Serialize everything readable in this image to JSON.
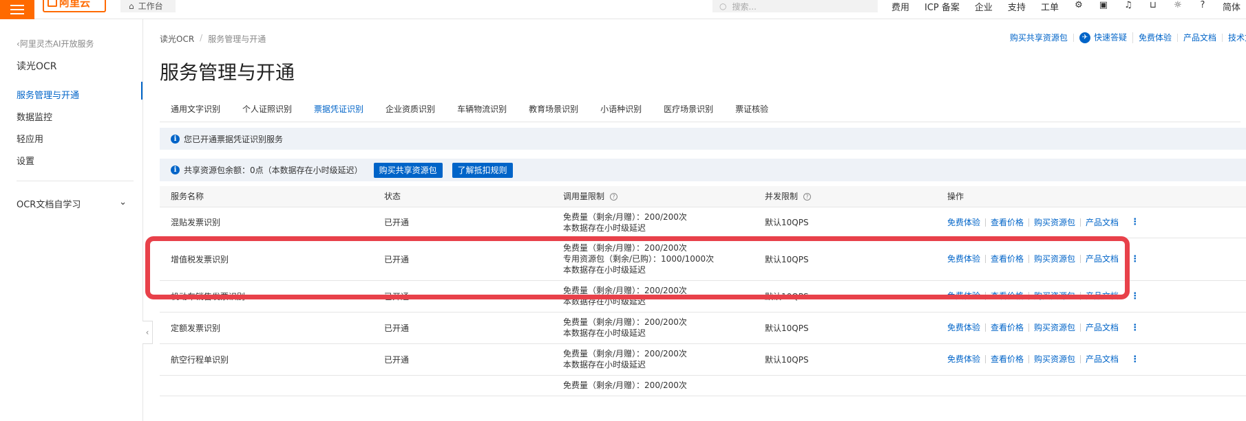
{
  "topbar": {
    "logo": "阿里云",
    "workbench": "工作台",
    "search_placeholder": "搜索...",
    "nav": [
      "费用",
      "ICP 备案",
      "企业",
      "支持",
      "工单"
    ],
    "lang": "简体",
    "icons": [
      "menu-icon",
      "home-icon",
      "search-icon",
      "robot-icon",
      "terminal-icon",
      "bell-icon",
      "cart-icon",
      "bulb-icon",
      "help-icon"
    ]
  },
  "sidebar": {
    "back": "阿里灵杰AI开放服务",
    "title": "读光OCR",
    "items": [
      "服务管理与开通",
      "数据监控",
      "轻应用",
      "设置"
    ],
    "collapse_item": "OCR文档自学习"
  },
  "breadcrumb": {
    "root": "读光OCR",
    "sep": "/",
    "current": "服务管理与开通"
  },
  "toplinks": [
    "购买共享资源包",
    "快速答疑",
    "免费体验",
    "产品文档",
    "技术文档"
  ],
  "page_title": "服务管理与开通",
  "tabs": [
    "通用文字识别",
    "个人证照识别",
    "票据凭证识别",
    "企业资质识别",
    "车辆物流识别",
    "教育场景识别",
    "小语种识别",
    "医疗场景识别",
    "票证核验"
  ],
  "active_tab": "票据凭证识别",
  "notice": "您已开通票据凭证识别服务",
  "quota": {
    "text": "共享资源包余额：0点（本数据存在小时级延迟）",
    "buy_button": "购买共享资源包",
    "rule_button": "了解抵扣规则"
  },
  "table": {
    "headers": [
      "服务名称",
      "状态",
      "调用量限制",
      "并发限制",
      "操作"
    ],
    "rows": [
      {
        "name": "混贴发票识别",
        "status": "已开通",
        "limits": [
          "免费量（剩余/月赠）：200/200次",
          "本数据存在小时级延迟"
        ],
        "concurrency": "默认10QPS"
      },
      {
        "name": "增值税发票识别",
        "status": "已开通",
        "limits": [
          "免费量（剩余/月赠）：200/200次",
          "专用资源包（剩余/已购）：1000/1000次",
          "本数据存在小时级延迟"
        ],
        "concurrency": "默认10QPS"
      },
      {
        "name": "机动车销售发票识别",
        "status": "已开通",
        "limits": [
          "免费量（剩余/月赠）：200/200次",
          "本数据存在小时级延迟"
        ],
        "concurrency": "默认10QPS"
      },
      {
        "name": "定额发票识别",
        "status": "已开通",
        "limits": [
          "免费量（剩余/月赠）：200/200次",
          "本数据存在小时级延迟"
        ],
        "concurrency": "默认10QPS"
      },
      {
        "name": "航空行程单识别",
        "status": "已开通",
        "limits": [
          "免费量（剩余/月赠）：200/200次",
          "本数据存在小时级延迟"
        ],
        "concurrency": "默认10QPS"
      },
      {
        "name": "",
        "status": "",
        "limits": [
          "免费量（剩余/月赠）：200/200次"
        ],
        "concurrency": ""
      }
    ],
    "ops": [
      "免费体验",
      "查看价格",
      "购买资源包",
      "产品文档"
    ]
  },
  "colors": {
    "accent": "#0064c8",
    "brand": "#ff6a00",
    "highlight": "#e8414a"
  }
}
